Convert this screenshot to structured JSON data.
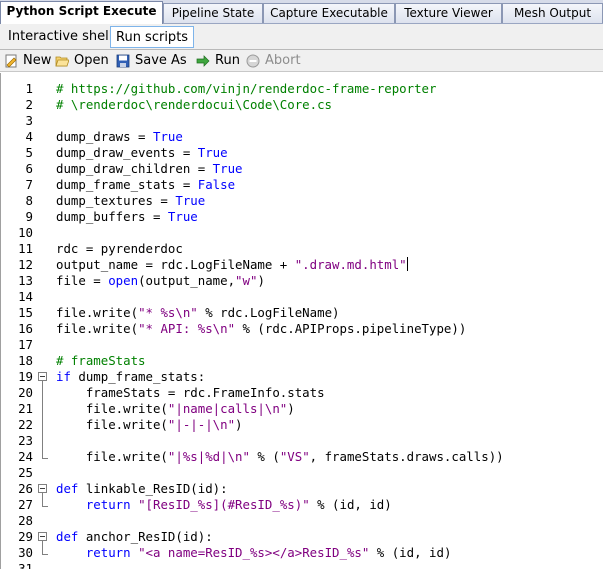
{
  "doc_tabs": [
    {
      "label": "Python Script Execute",
      "active": true
    },
    {
      "label": "Pipeline State",
      "active": false
    },
    {
      "label": "Capture Executable",
      "active": false
    },
    {
      "label": "Texture Viewer",
      "active": false
    },
    {
      "label": "Mesh Output",
      "active": false
    }
  ],
  "inner_tabs": [
    {
      "label": "Interactive shell",
      "active": false
    },
    {
      "label": "Run scripts",
      "active": true
    }
  ],
  "toolbar": {
    "new_label": "New",
    "open_label": "Open",
    "save_as_label": "Save As",
    "run_label": "Run",
    "abort_label": "Abort",
    "icons": {
      "new": "new-file-icon",
      "open": "open-folder-icon",
      "save_as": "save-disk-icon",
      "run": "run-arrow-icon",
      "abort": "abort-icon"
    }
  },
  "editor": {
    "lines": [
      {
        "n": "1",
        "t": [
          [
            "c",
            "# https://github.com/vinjn/renderdoc-frame-reporter"
          ]
        ]
      },
      {
        "n": "2",
        "t": [
          [
            "c",
            "# \\renderdoc\\renderdocui\\Code\\Core.cs"
          ]
        ]
      },
      {
        "n": "3",
        "t": []
      },
      {
        "n": "4",
        "t": [
          [
            "p",
            "dump_draws = "
          ],
          [
            "k",
            "True"
          ]
        ]
      },
      {
        "n": "5",
        "t": [
          [
            "p",
            "dump_draw_events = "
          ],
          [
            "k",
            "True"
          ]
        ]
      },
      {
        "n": "6",
        "t": [
          [
            "p",
            "dump_draw_children = "
          ],
          [
            "k",
            "True"
          ]
        ]
      },
      {
        "n": "7",
        "t": [
          [
            "p",
            "dump_frame_stats = "
          ],
          [
            "k",
            "False"
          ]
        ]
      },
      {
        "n": "8",
        "t": [
          [
            "p",
            "dump_textures = "
          ],
          [
            "k",
            "True"
          ]
        ]
      },
      {
        "n": "9",
        "t": [
          [
            "p",
            "dump_buffers = "
          ],
          [
            "k",
            "True"
          ]
        ]
      },
      {
        "n": "10",
        "t": []
      },
      {
        "n": "11",
        "t": [
          [
            "p",
            "rdc = pyrenderdoc"
          ]
        ]
      },
      {
        "n": "12",
        "t": [
          [
            "p",
            "output_name = rdc.LogFileName + "
          ],
          [
            "s",
            "\".draw.md.html\""
          ]
        ],
        "caret": true
      },
      {
        "n": "13",
        "t": [
          [
            "p",
            "file = "
          ],
          [
            "k",
            "open"
          ],
          [
            "p",
            "(output_name,"
          ],
          [
            "s",
            "\"w\""
          ],
          [
            "p",
            ")"
          ]
        ]
      },
      {
        "n": "14",
        "t": []
      },
      {
        "n": "15",
        "t": [
          [
            "p",
            "file.write("
          ],
          [
            "s",
            "\"* %s\\n\""
          ],
          [
            "p",
            " % rdc.LogFileName)"
          ]
        ]
      },
      {
        "n": "16",
        "t": [
          [
            "p",
            "file.write("
          ],
          [
            "s",
            "\"* API: %s\\n\""
          ],
          [
            "p",
            " % (rdc.APIProps.pipelineType))"
          ]
        ]
      },
      {
        "n": "17",
        "t": []
      },
      {
        "n": "18",
        "t": [
          [
            "c",
            "# frameStats"
          ]
        ]
      },
      {
        "n": "19",
        "t": [
          [
            "k",
            "if"
          ],
          [
            "p",
            " dump_frame_stats:"
          ]
        ],
        "fold": "start"
      },
      {
        "n": "20",
        "t": [
          [
            "p",
            "    frameStats = rdc.FrameInfo.stats"
          ]
        ],
        "fold": "mid"
      },
      {
        "n": "21",
        "t": [
          [
            "p",
            "    file.write("
          ],
          [
            "s",
            "\"|name|calls|\\n\""
          ],
          [
            "p",
            ")"
          ]
        ],
        "fold": "mid"
      },
      {
        "n": "22",
        "t": [
          [
            "p",
            "    file.write("
          ],
          [
            "s",
            "\"|-|-|\\n\""
          ],
          [
            "p",
            ")"
          ]
        ],
        "fold": "mid"
      },
      {
        "n": "23",
        "t": [],
        "fold": "mid"
      },
      {
        "n": "24",
        "t": [
          [
            "p",
            "    file.write("
          ],
          [
            "s",
            "\"|%s|%d|\\n\""
          ],
          [
            "p",
            " % ("
          ],
          [
            "s",
            "\"VS\""
          ],
          [
            "p",
            ", frameStats.draws.calls))"
          ]
        ],
        "fold": "end"
      },
      {
        "n": "25",
        "t": []
      },
      {
        "n": "26",
        "t": [
          [
            "k",
            "def"
          ],
          [
            "p",
            " linkable_ResID(id):"
          ]
        ],
        "fold": "start"
      },
      {
        "n": "27",
        "t": [
          [
            "p",
            "    "
          ],
          [
            "k",
            "return"
          ],
          [
            "p",
            " "
          ],
          [
            "s",
            "\"[ResID_%s](#ResID_%s)\""
          ],
          [
            "p",
            " % (id, id)"
          ]
        ],
        "fold": "end"
      },
      {
        "n": "28",
        "t": []
      },
      {
        "n": "29",
        "t": [
          [
            "k",
            "def"
          ],
          [
            "p",
            " anchor_ResID(id):"
          ]
        ],
        "fold": "start"
      },
      {
        "n": "30",
        "t": [
          [
            "p",
            "    "
          ],
          [
            "k",
            "return"
          ],
          [
            "p",
            " "
          ],
          [
            "s",
            "\"<a name=ResID_%s></a>ResID_%s\""
          ],
          [
            "p",
            " % (id, id)"
          ]
        ],
        "fold": "end"
      },
      {
        "n": "31",
        "t": []
      }
    ]
  },
  "colors": {
    "keyword": "#0000ff",
    "string": "#800080",
    "comment": "#008000",
    "plain": "#000000"
  }
}
